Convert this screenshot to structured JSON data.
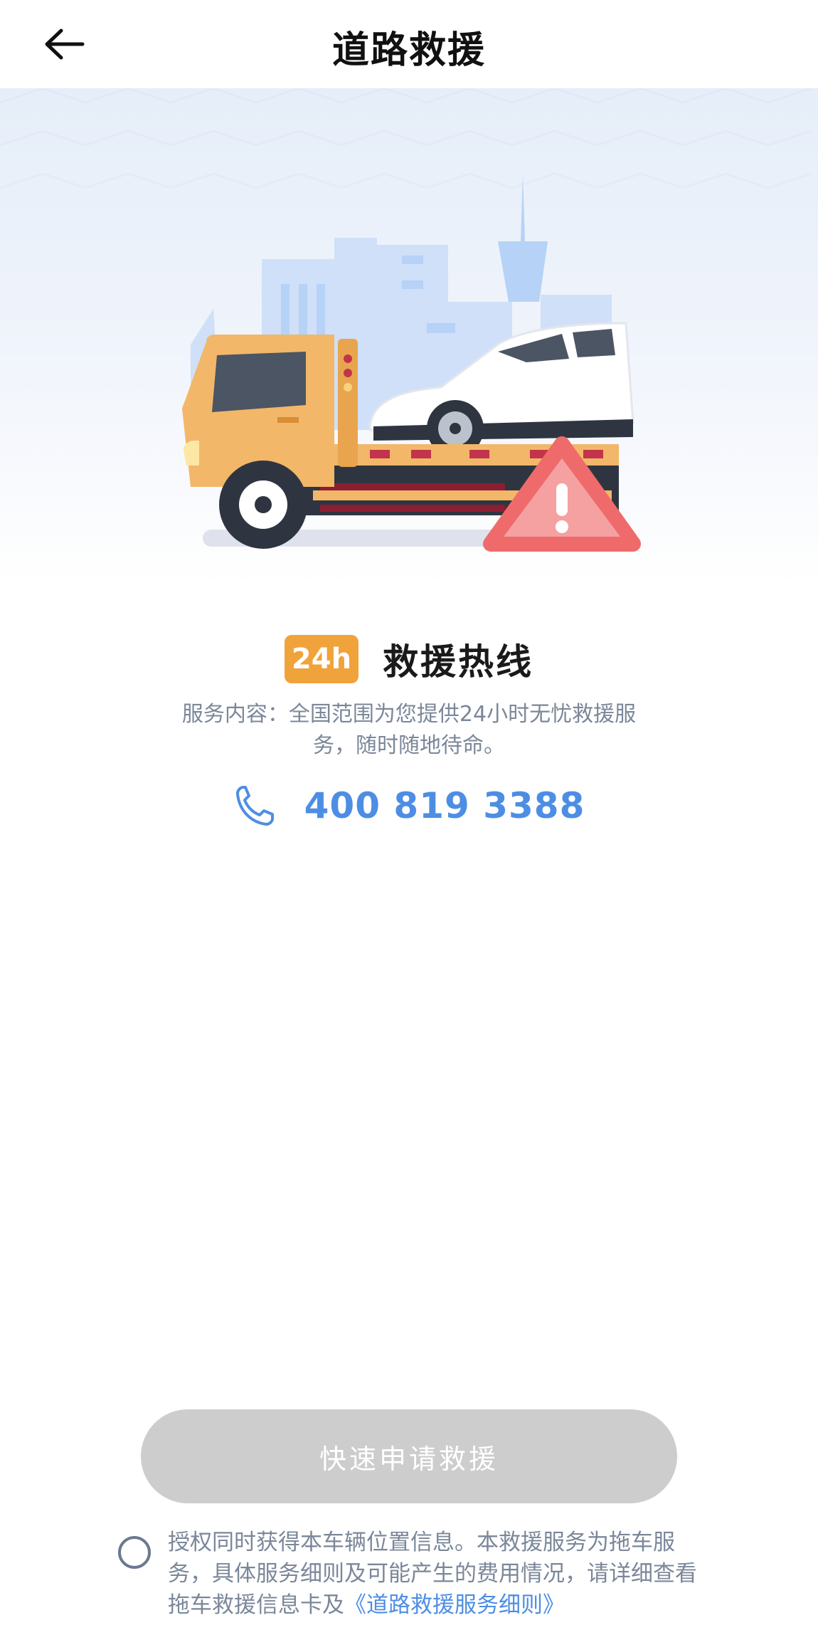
{
  "header": {
    "title": "道路救援",
    "back_icon": "arrow-left-icon"
  },
  "hero": {
    "illustration": "tow-truck-illustration"
  },
  "hotline": {
    "badge": "24h",
    "label": "救援热线",
    "description": "服务内容：全国范围为您提供24小时无忧救援服务，随时随地待命。",
    "phone_icon": "phone-icon",
    "phone_number": "400 819 3388"
  },
  "actions": {
    "apply_label": "快速申请救援"
  },
  "agreement": {
    "text": "授权同时获得本车辆位置信息。本救援服务为拖车服务，具体服务细则及可能产生的费用情况，请详细查看拖车救援信息卡及",
    "link_text": "《道路救援服务细则》"
  },
  "colors": {
    "accent_blue": "#4d8ee4",
    "badge_orange": "#f0a33a",
    "button_disabled": "#cdcdcd",
    "text_gray": "#7b8799"
  }
}
